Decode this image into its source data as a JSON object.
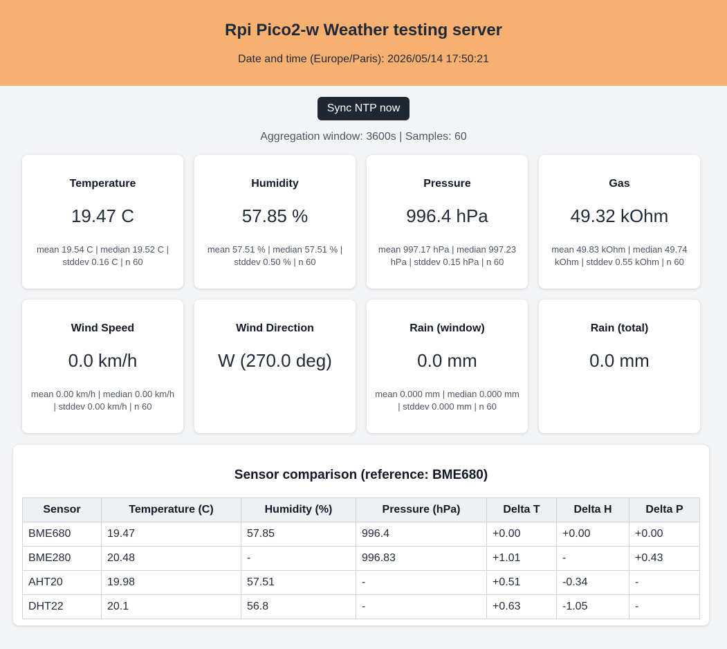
{
  "header": {
    "title": "Rpi Pico2-w Weather testing server",
    "datetime": "Date and time (Europe/Paris): 2026/05/14 17:50:21"
  },
  "controls": {
    "sync_label": "Sync NTP now",
    "aggregation": "Aggregation window: 3600s | Samples: 60"
  },
  "cards": [
    {
      "label": "Temperature",
      "value": "19.47 C",
      "stats": "mean 19.54 C | median 19.52 C | stddev 0.16 C | n 60"
    },
    {
      "label": "Humidity",
      "value": "57.85 %",
      "stats": "mean 57.51 % | median 57.51 % | stddev 0.50 % | n 60"
    },
    {
      "label": "Pressure",
      "value": "996.4 hPa",
      "stats": "mean 997.17 hPa | median 997.23 hPa | stddev 0.15 hPa | n 60"
    },
    {
      "label": "Gas",
      "value": "49.32 kOhm",
      "stats": "mean 49.83 kOhm | median 49.74 kOhm | stddev 0.55 kOhm | n 60"
    },
    {
      "label": "Wind Speed",
      "value": "0.0 km/h",
      "stats": "mean 0.00 km/h | median 0.00 km/h | stddev 0.00 km/h | n 60"
    },
    {
      "label": "Wind Direction",
      "value": "W (270.0 deg)",
      "stats": ""
    },
    {
      "label": "Rain (window)",
      "value": "0.0 mm",
      "stats": "mean 0.000 mm | median 0.000 mm | stddev 0.000 mm | n 60"
    },
    {
      "label": "Rain (total)",
      "value": "0.0 mm",
      "stats": ""
    }
  ],
  "comparison": {
    "title": "Sensor comparison (reference: BME680)",
    "headers": [
      "Sensor",
      "Temperature (C)",
      "Humidity (%)",
      "Pressure (hPa)",
      "Delta T",
      "Delta H",
      "Delta P"
    ],
    "rows": [
      [
        "BME680",
        "19.47",
        "57.85",
        "996.4",
        "+0.00",
        "+0.00",
        "+0.00"
      ],
      [
        "BME280",
        "20.48",
        "-",
        "996.83",
        "+1.01",
        "-",
        "+0.43"
      ],
      [
        "AHT20",
        "19.98",
        "57.51",
        "-",
        "+0.51",
        "-0.34",
        "-"
      ],
      [
        "DHT22",
        "20.1",
        "56.8",
        "-",
        "+0.63",
        "-1.05",
        "-"
      ]
    ]
  }
}
